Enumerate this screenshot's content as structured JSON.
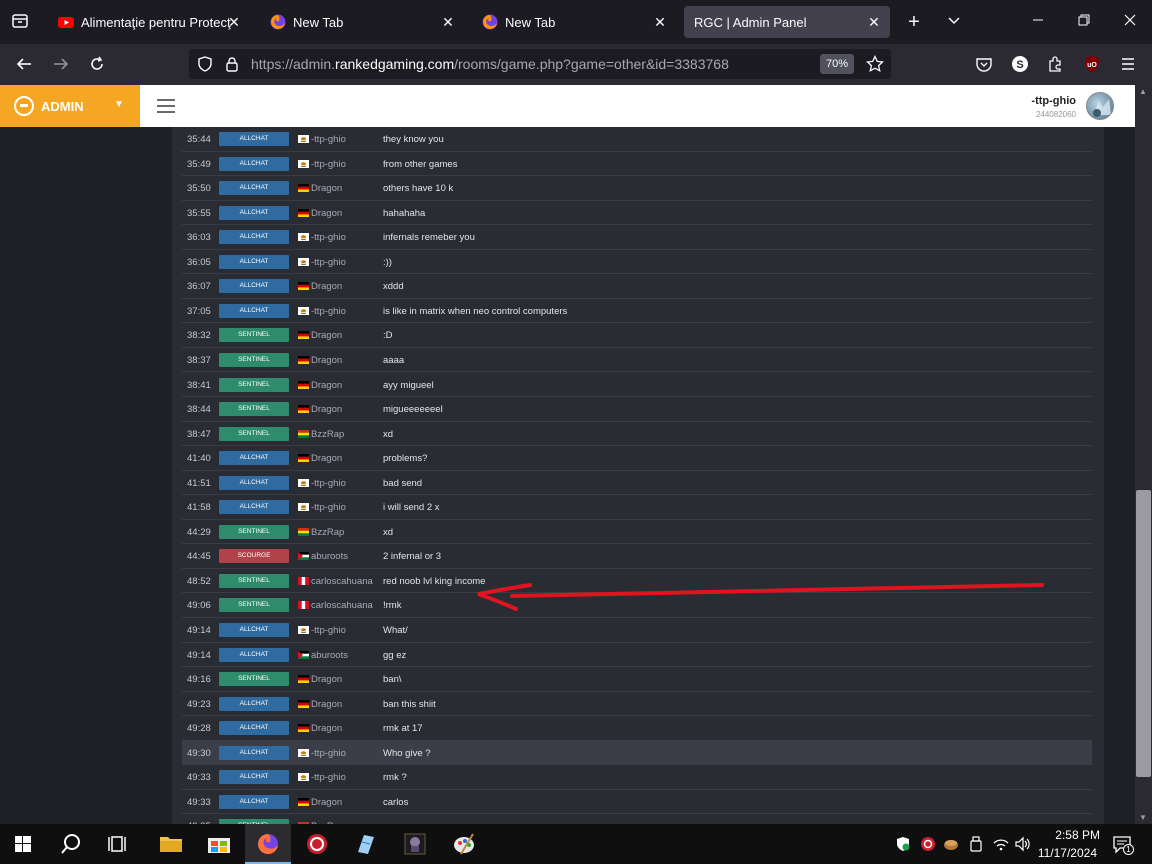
{
  "browser": {
    "tabs": [
      {
        "label": "Alimentaţie pentru Protecţie",
        "icon": "youtube-icon"
      },
      {
        "label": "New Tab",
        "icon": "firefox-icon"
      },
      {
        "label": "New Tab",
        "icon": "firefox-icon"
      },
      {
        "label": "RGC | Admin Panel",
        "icon": "none",
        "active": true
      }
    ],
    "url_prefix": "https://admin.",
    "url_host": "rankedgaming.com",
    "url_path": "/rooms/game.php?game=other&id=3383768",
    "zoom": "70%"
  },
  "admin": {
    "brand": "ADMIN",
    "user_name": "-ttp-ghio",
    "user_id": "244082060"
  },
  "chat": [
    {
      "time": "35:44",
      "channel": "ALLCHAT",
      "flag": "cy",
      "player": "-ttp-ghio",
      "msg": "they know you"
    },
    {
      "time": "35:49",
      "channel": "ALLCHAT",
      "flag": "cy",
      "player": "-ttp-ghio",
      "msg": "from other games"
    },
    {
      "time": "35:50",
      "channel": "ALLCHAT",
      "flag": "de",
      "player": "Dragon",
      "msg": "others have 10 k"
    },
    {
      "time": "35:55",
      "channel": "ALLCHAT",
      "flag": "de",
      "player": "Dragon",
      "msg": "hahahaha"
    },
    {
      "time": "36:03",
      "channel": "ALLCHAT",
      "flag": "cy",
      "player": "-ttp-ghio",
      "msg": "infernals remeber you"
    },
    {
      "time": "36:05",
      "channel": "ALLCHAT",
      "flag": "cy",
      "player": "-ttp-ghio",
      "msg": ":))"
    },
    {
      "time": "36:07",
      "channel": "ALLCHAT",
      "flag": "de",
      "player": "Dragon",
      "msg": "xddd"
    },
    {
      "time": "37:05",
      "channel": "ALLCHAT",
      "flag": "cy",
      "player": "-ttp-ghio",
      "msg": "is like in matrix when neo control computers"
    },
    {
      "time": "38:32",
      "channel": "SENTINEL",
      "flag": "de",
      "player": "Dragon",
      "msg": ":D"
    },
    {
      "time": "38:37",
      "channel": "SENTINEL",
      "flag": "de",
      "player": "Dragon",
      "msg": "aaaa"
    },
    {
      "time": "38:41",
      "channel": "SENTINEL",
      "flag": "de",
      "player": "Dragon",
      "msg": "ayy migueel"
    },
    {
      "time": "38:44",
      "channel": "SENTINEL",
      "flag": "de",
      "player": "Dragon",
      "msg": "migueeeeeeel"
    },
    {
      "time": "38:47",
      "channel": "SENTINEL",
      "flag": "bo",
      "player": "BzzRap",
      "msg": "xd"
    },
    {
      "time": "41:40",
      "channel": "ALLCHAT",
      "flag": "de",
      "player": "Dragon",
      "msg": "problems?"
    },
    {
      "time": "41:51",
      "channel": "ALLCHAT",
      "flag": "cy",
      "player": "-ttp-ghio",
      "msg": "bad send"
    },
    {
      "time": "41:58",
      "channel": "ALLCHAT",
      "flag": "cy",
      "player": "-ttp-ghio",
      "msg": "i will send 2 x"
    },
    {
      "time": "44:29",
      "channel": "SENTINEL",
      "flag": "bo",
      "player": "BzzRap",
      "msg": "xd"
    },
    {
      "time": "44:45",
      "channel": "SCOURGE",
      "flag": "jo",
      "player": "aburoots",
      "msg": "2 infernal or 3"
    },
    {
      "time": "48:52",
      "channel": "SENTINEL",
      "flag": "pe",
      "player": "carloscahuana",
      "msg": "red noob lvl king income"
    },
    {
      "time": "49:06",
      "channel": "SENTINEL",
      "flag": "pe",
      "player": "carloscahuana",
      "msg": "!rmk"
    },
    {
      "time": "49:14",
      "channel": "ALLCHAT",
      "flag": "cy",
      "player": "-ttp-ghio",
      "msg": "What/"
    },
    {
      "time": "49:14",
      "channel": "ALLCHAT",
      "flag": "jo",
      "player": "aburoots",
      "msg": "gg ez"
    },
    {
      "time": "49:16",
      "channel": "SENTINEL",
      "flag": "de",
      "player": "Dragon",
      "msg": "ban\\"
    },
    {
      "time": "49:23",
      "channel": "ALLCHAT",
      "flag": "de",
      "player": "Dragon",
      "msg": "ban this shiit"
    },
    {
      "time": "49:28",
      "channel": "ALLCHAT",
      "flag": "de",
      "player": "Dragon",
      "msg": "rmk at 17"
    },
    {
      "time": "49:30",
      "channel": "ALLCHAT",
      "flag": "cy",
      "player": "-ttp-ghio",
      "msg": "Who give ?",
      "highlight": true
    },
    {
      "time": "49:33",
      "channel": "ALLCHAT",
      "flag": "cy",
      "player": "-ttp-ghio",
      "msg": "rmk ?"
    },
    {
      "time": "49:33",
      "channel": "ALLCHAT",
      "flag": "de",
      "player": "Dragon",
      "msg": "carlos"
    },
    {
      "time": "49:35",
      "channel": "SENTINEL",
      "flag": "bo",
      "player": "BzzRap",
      "msg": "gg"
    }
  ],
  "taskbar": {
    "time": "2:58 PM",
    "date": "11/17/2024",
    "notification_count": "1"
  },
  "colors": {
    "brand": "#f5a623",
    "allchat": "#2f6aa0",
    "sentinel": "#2e8b6b",
    "scourge": "#b0434a",
    "annotation": "#e0141e"
  }
}
